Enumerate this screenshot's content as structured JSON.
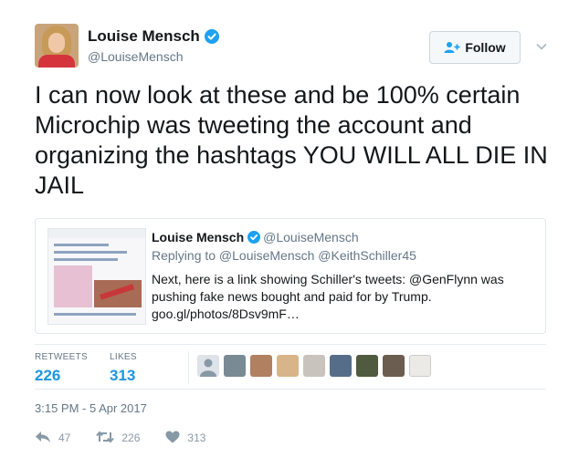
{
  "header": {
    "display_name": "Louise Mensch",
    "handle": "@LouiseMensch",
    "follow_label": "Follow"
  },
  "tweet": {
    "text": "I can now look at these and be 100% certain Microchip was tweeting the account and organizing the hashtags YOU WILL ALL DIE IN JAIL"
  },
  "quote": {
    "display_name": "Louise Mensch",
    "handle": "@LouiseMensch",
    "reply_to": "Replying to @LouiseMensch @KeithSchiller45",
    "body": "Next, here is a link showing Schiller's tweets: @GenFlynn was pushing fake news bought and paid for by Trump. goo.gl/photos/8Dsv9mF…"
  },
  "stats": {
    "retweets_label": "RETWEETS",
    "retweets_value": "226",
    "likes_label": "LIKES",
    "likes_value": "313"
  },
  "timestamp": "3:15 PM - 5 Apr 2017",
  "actions": {
    "reply_count": "47",
    "retweet_count": "226",
    "like_count": "313"
  },
  "colors": {
    "accent": "#1b95e0",
    "muted": "#657786",
    "icon": "#8899a6",
    "border": "#e1e8ed"
  },
  "icons": {
    "verified": "verified-badge-icon",
    "follow": "add-person-icon",
    "more": "chevron-down-icon",
    "reply": "reply-icon",
    "retweet": "retweet-icon",
    "like": "heart-icon"
  }
}
